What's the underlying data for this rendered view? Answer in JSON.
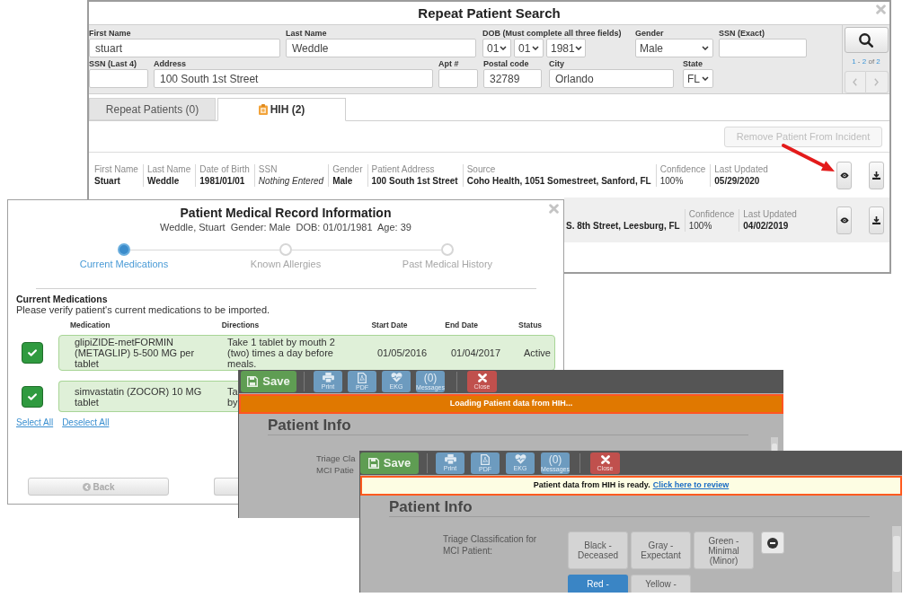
{
  "search_window": {
    "title": "Repeat Patient Search",
    "fields": [
      [
        {
          "kind": "input",
          "label": "First Name",
          "value": "stuart"
        },
        {
          "kind": "input",
          "label": "Last Name",
          "value": "Weddle"
        },
        {
          "kind": "date",
          "label": "DOB (Must complete all three fields)",
          "parts": [
            "01",
            "01",
            "1981"
          ]
        },
        {
          "kind": "select",
          "label": "Gender",
          "value": "Male"
        },
        {
          "kind": "input",
          "label": "SSN (Exact)"
        }
      ],
      [
        {
          "kind": "input",
          "label": "SSN (Last 4)"
        },
        {
          "kind": "input",
          "label": "Address",
          "value": "100 South 1st Street"
        },
        {
          "kind": "input",
          "label": "Apt #"
        },
        {
          "kind": "input",
          "label": "Postal code",
          "value": "32789"
        },
        {
          "kind": "input",
          "label": "City",
          "value": "Orlando"
        },
        {
          "kind": "select",
          "label": "State",
          "value": "FL"
        }
      ]
    ],
    "result_count": [
      {
        "kind": "number",
        "text": "1"
      },
      {
        "kind": "word",
        "text": "-"
      },
      {
        "kind": "number",
        "text": "2"
      },
      {
        "kind": "word",
        "text": "of"
      },
      {
        "kind": "number",
        "text": "2"
      }
    ],
    "tabs": [
      {
        "kind": "plain",
        "label": "Repeat Patients (0)",
        "selected": false
      },
      {
        "kind": "hih",
        "label": "HIH (2)",
        "selected": true
      }
    ],
    "remove_button": {
      "label": "Remove Patient From Incident",
      "disabled": true
    },
    "results": [
      {
        "fields": [
          {
            "label": "First Name",
            "value": "Stuart",
            "kind": "bold"
          },
          {
            "label": "Last Name",
            "value": "Weddle",
            "kind": "bold"
          },
          {
            "label": "Date of Birth",
            "value": "1981/01/01",
            "kind": "bold"
          },
          {
            "label": "SSN",
            "value": "Nothing Entered",
            "kind": "italic"
          },
          {
            "label": "Gender",
            "value": "Male",
            "kind": "bold"
          },
          {
            "label": "Patient Address",
            "value": "100 South 1st Street",
            "kind": "bold"
          },
          {
            "label": "Source",
            "value": "Coho Health, 1051 Somestreet, Sanford, FL",
            "kind": "bold"
          },
          {
            "label": "Confidence",
            "value": "100%",
            "kind": "plain"
          },
          {
            "label": "Last Updated",
            "value": "05/29/2020",
            "kind": "bold"
          }
        ]
      },
      {
        "fields": [
          {
            "value": "S. 8th Street, Leesburg, FL",
            "kind": "bold"
          },
          {
            "label": "Confidence",
            "value": "100%",
            "kind": "plain"
          },
          {
            "label": "Last Updated",
            "value": "04/02/2019",
            "kind": "bold"
          }
        ]
      }
    ]
  },
  "medical_record_window": {
    "title": "Patient Medical Record Information",
    "subtitle": "Weddle, Stuart  Gender: Male  DOB: 01/01/1981  Age: 39",
    "steps": [
      {
        "label": "Current Medications",
        "selected": true
      },
      {
        "label": "Known Allergies",
        "selected": false
      },
      {
        "label": "Past Medical History",
        "selected": false
      }
    ],
    "section_title": "Current Medications",
    "section_hint": "Please verify patient's current medications to be imported.",
    "columns": [
      "Medication",
      "Directions",
      "Start Date",
      "End Date",
      "Status"
    ],
    "rows": [
      {
        "checked": true,
        "cells": [
          "glipiZIDE-metFORMIN (METAGLIP) 5-500 MG per tablet",
          "Take 1 tablet by mouth 2 (two) times a day before meals.",
          "01/05/2016",
          "01/04/2017",
          "Active"
        ]
      },
      {
        "checked": true,
        "cells": [
          "simvastatin (ZOCOR) 10 MG tablet",
          "Ta\nby"
        ]
      }
    ],
    "links": [
      "Select All",
      "Deselect All"
    ],
    "buttons": [
      {
        "kind": "back",
        "label": "Back",
        "disabled": true
      },
      {
        "kind": "plain"
      }
    ]
  },
  "patient_forms": [
    {
      "toolbar": [
        {
          "kind": "save",
          "label": "Save"
        },
        {
          "kind": "print",
          "label": "Print"
        },
        {
          "kind": "pdf",
          "label": "PDF"
        },
        {
          "kind": "ekg",
          "label": "EKG"
        },
        {
          "kind": "messages",
          "count": "(0)",
          "label": "Messages"
        },
        {
          "kind": "close",
          "label": "Close"
        }
      ],
      "banner": {
        "kind": "loading",
        "text": "Loading Patient data from HIH..."
      },
      "heading": "Patient Info",
      "triage_label": "Triage Cla\nMCI Patie"
    },
    {
      "toolbar": [
        {
          "kind": "save",
          "label": "Save"
        },
        {
          "kind": "print",
          "label": "Print"
        },
        {
          "kind": "pdf",
          "label": "PDF"
        },
        {
          "kind": "ekg",
          "label": "EKG"
        },
        {
          "kind": "messages",
          "count": "(0)",
          "label": "Messages"
        },
        {
          "kind": "close",
          "label": "Close"
        }
      ],
      "banner": {
        "kind": "ready",
        "text": "Patient data from HIH is ready.",
        "link": "Click here to review"
      },
      "heading": "Patient Info",
      "triage_label": "Triage Classification for MCI Patient:",
      "triage_options": [
        {
          "label": "Black - Deceased",
          "selected": false
        },
        {
          "label": "Gray - Expectant",
          "selected": false
        },
        {
          "label": "Green - Minimal (Minor)",
          "selected": false
        },
        {
          "label": "Red -",
          "selected": true
        },
        {
          "label": "Yellow -",
          "selected": false
        }
      ]
    }
  ]
}
